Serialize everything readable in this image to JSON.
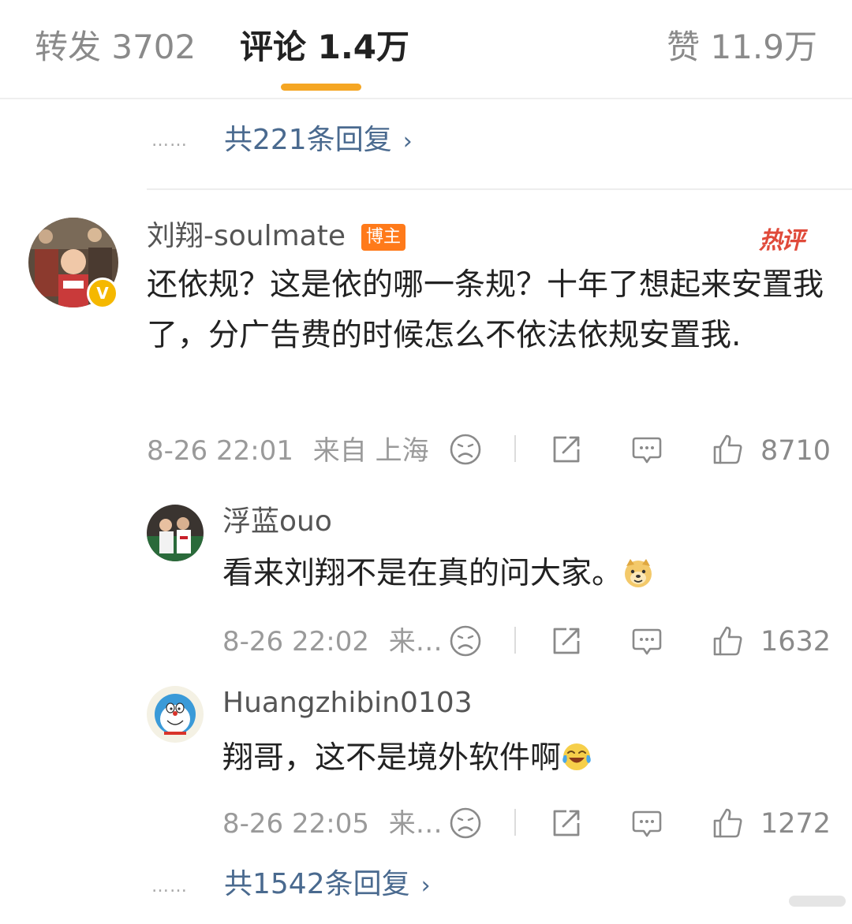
{
  "tabs": {
    "repost": "转发 3702",
    "comment": "评论 1.4万",
    "like": "赞 11.9万"
  },
  "top_thread": {
    "dots": "……",
    "link": "共221条回复"
  },
  "main_comment": {
    "username": "刘翔-soulmate",
    "owner_badge": "博主",
    "hot_badge": "热评",
    "text": "还依规？这是依的哪一条规？十年了想起来安置我了，分广告费的时候怎么不依法依规安置我.",
    "time": "8-26 22:01",
    "location": "来自 上海",
    "likes": "8710"
  },
  "replies": [
    {
      "username": "浮蓝ouo",
      "text": "看来刘翔不是在真的问大家。",
      "emoji": "doge-emoji",
      "time": "8-26 22:02",
      "location": "来…",
      "likes": "1632"
    },
    {
      "username": "Huangzhibin0103",
      "text": "翔哥，这不是境外软件啊",
      "emoji": "laughing-crying-emoji",
      "time": "8-26 22:05",
      "location": "来…",
      "likes": "1272"
    }
  ],
  "bottom_thread": {
    "dots": "……",
    "link": "共1542条回复"
  },
  "icons": [
    "sad-face-icon",
    "share-icon",
    "comment-icon",
    "thumbs-up-icon",
    "verified-icon",
    "chevron-right-icon"
  ],
  "colors": {
    "accent": "#f5a623",
    "link": "#4a6a8f",
    "owner_badge": "#ff7a1a",
    "hot": "#e04a3a"
  }
}
